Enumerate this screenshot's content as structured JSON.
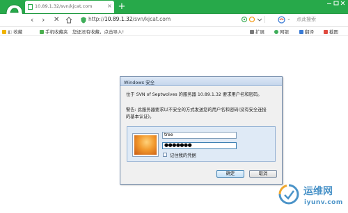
{
  "browser": {
    "tab_title": "10.89.1.32/svn/kjcat.com",
    "new_tab_label": "+",
    "url_scheme": "http://",
    "url_host": "10.89.1.32",
    "url_path": "/svn/kjcat.com",
    "search_placeholder": "点此搜索",
    "nav": {
      "back": "‹",
      "forward": "›",
      "reload": "✕"
    }
  },
  "bookmarks": {
    "favorites": "收藏",
    "mobile_favorites": "手机收藏夹",
    "notice": "您还没有收藏，点击导入!",
    "extensions": "扩展",
    "online_banking": "网银",
    "translate": "翻译",
    "screenshot": "截图"
  },
  "dialog": {
    "title": "Windows 安全",
    "message_line": "位于 SVN of Septwolves 的服务器 10.89.1.32 要求用户名和密码。",
    "warning_line1": "警告: 此服务器要求以不安全的方式发送您的用户名和密码(没有安全连接",
    "warning_line2": "的基本认证)。",
    "username": "tree",
    "password_mask": "●●●●●●●",
    "remember_label": "记住我的凭据",
    "ok_label": "确定",
    "cancel_label": "取消"
  },
  "watermark": {
    "cn": "运维网",
    "en": "iyunv.com"
  },
  "colors": {
    "browser_green": "#27a94a",
    "dialog_border": "#6d87a8",
    "watermark_blue": "#4a93c8"
  }
}
